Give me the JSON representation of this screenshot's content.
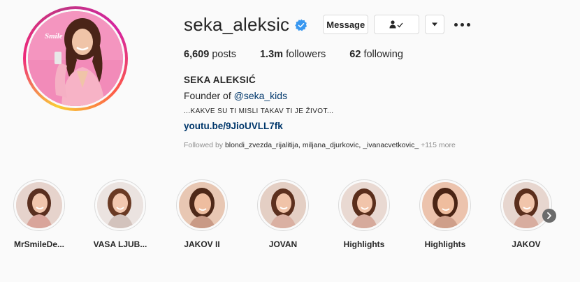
{
  "profile": {
    "username": "seka_aleksic",
    "verified": true,
    "avatar_text": "Smile",
    "buttons": {
      "message": "Message",
      "follow_icon": "person-check-icon",
      "dropdown_icon": "caret-down-icon",
      "more_icon": "more-options-icon"
    }
  },
  "stats": {
    "posts_count": "6,609",
    "posts_label": " posts",
    "followers_count": "1.3m",
    "followers_label": " followers",
    "following_count": "62",
    "following_label": " following"
  },
  "bio": {
    "name": "SEKA ALEKSIĆ",
    "founder_prefix": "Founder of ",
    "founder_link": "@seka_kids",
    "caps_line": "...KAKVE SU TI MISLI TAKAV TI JE ŽIVOT...",
    "url": "youtu.be/9JioUVLL7fk",
    "followed_by_prefix": "Followed by ",
    "followed_by_names": "blondi_zvezda_rijalitija, miljana_djurkovic, _ivanacvetkovic_",
    "followed_by_more": " +115 more"
  },
  "highlights": [
    {
      "label": "MrSmileDe..."
    },
    {
      "label": "VASA LJUB..."
    },
    {
      "label": "JAKOV II"
    },
    {
      "label": "JOVAN"
    },
    {
      "label": "Highlights"
    },
    {
      "label": "Highlights"
    },
    {
      "label": "JAKOV"
    }
  ],
  "colors": {
    "link": "#00376b",
    "verified_blue": "#3897f0",
    "muted": "#8e8e8e"
  }
}
